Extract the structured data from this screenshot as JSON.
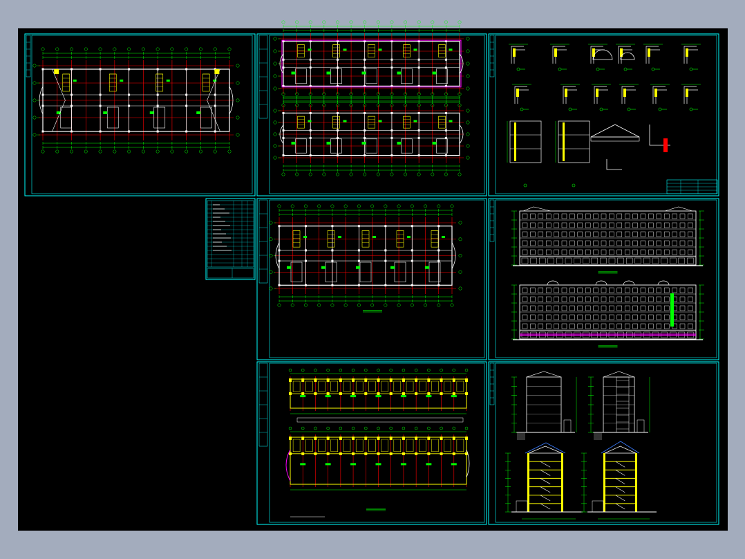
{
  "canvas": {
    "background": "#a3acbd",
    "model_space": "#000000",
    "colors": {
      "cyan": "#00ffff",
      "green": "#00ff00",
      "red": "#ff0000",
      "yellow": "#ffff00",
      "white": "#ffffff",
      "magenta": "#ff00ff",
      "blue": "#3a7dff"
    }
  },
  "sheets": [
    {
      "id": "upper-floor-plan",
      "kind": "plan"
    },
    {
      "id": "floor-plans-a",
      "kind": "dual-plan"
    },
    {
      "id": "details",
      "kind": "details"
    },
    {
      "id": "standard-floor-plan",
      "kind": "plan"
    },
    {
      "id": "elevations",
      "kind": "elevations"
    },
    {
      "id": "ground-floor-plans",
      "kind": "dual-plan"
    },
    {
      "id": "sections",
      "kind": "sections"
    }
  ],
  "drawing_index": {
    "kind": "table"
  }
}
